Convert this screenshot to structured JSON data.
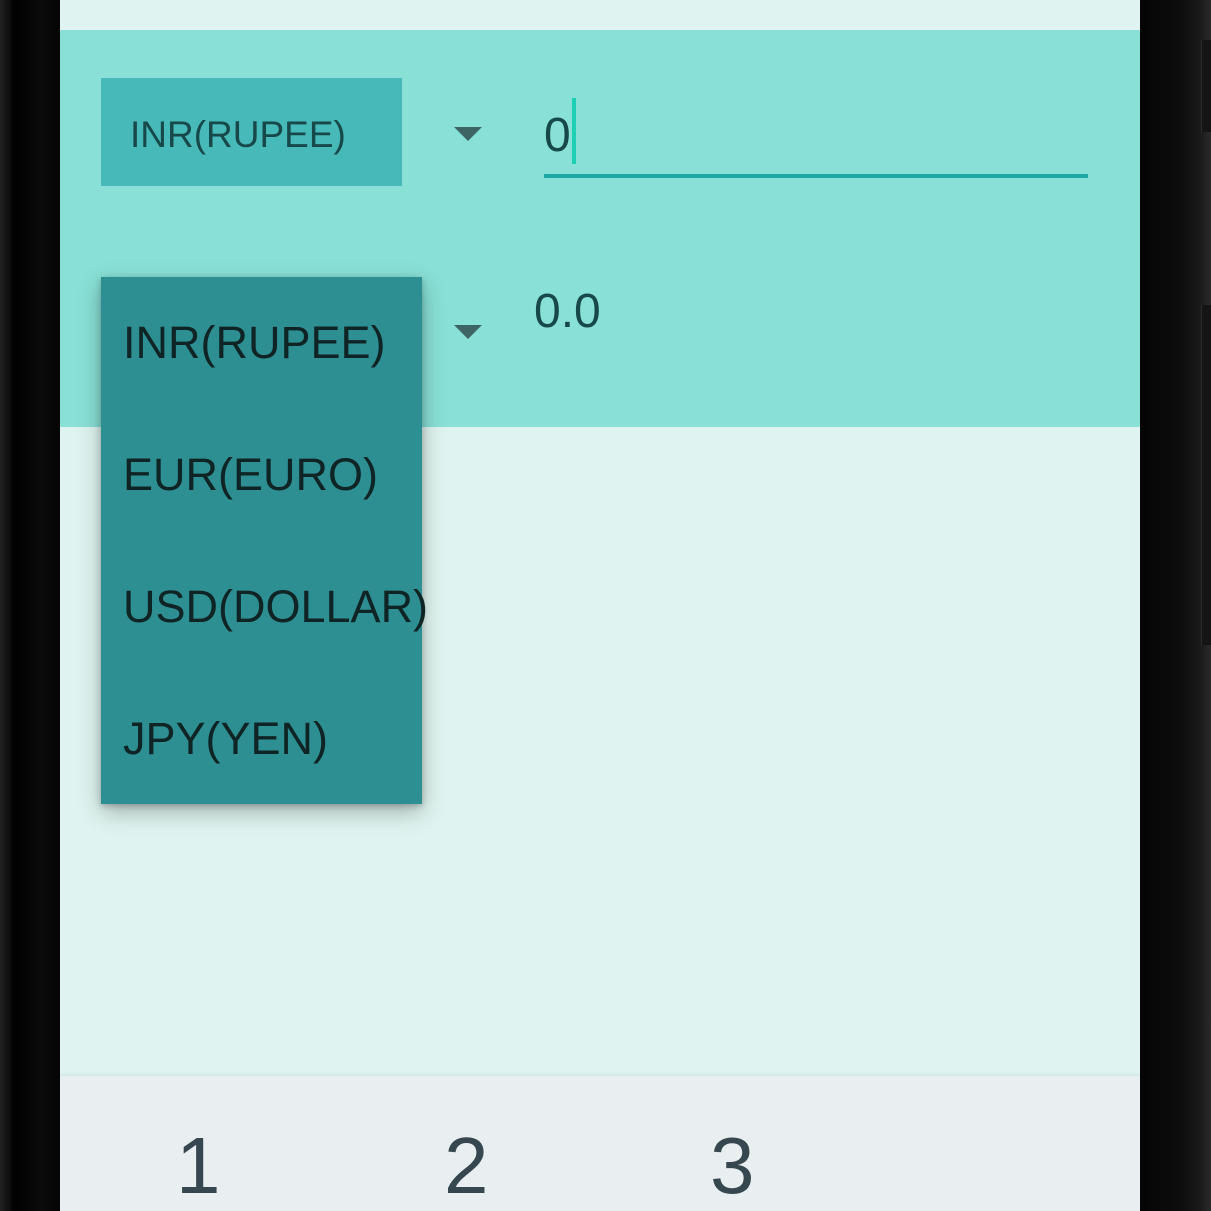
{
  "converter": {
    "from_currency": "INR(RUPEE)",
    "amount_value": "0",
    "result_value": "0.0"
  },
  "dropdown": {
    "options": [
      {
        "label": "INR(RUPEE)"
      },
      {
        "label": "EUR(EURO)"
      },
      {
        "label": "USD(DOLLAR)"
      },
      {
        "label": "JPY(YEN)"
      }
    ]
  },
  "keyboard": {
    "keys": [
      "1",
      "2",
      "3"
    ]
  },
  "colors": {
    "panel": "#89e0d6",
    "background": "#dff4f0",
    "spinner": "#47b9b9",
    "dropdown": "#2e8f93",
    "accent": "#1ba9a6"
  },
  "icons": {
    "dropdown_arrow": "caret-down-icon",
    "text_caret": "text-cursor-icon"
  }
}
